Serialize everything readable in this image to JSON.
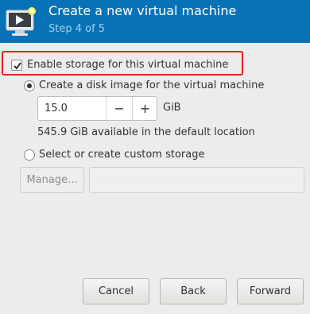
{
  "header": {
    "title": "Create a new virtual machine",
    "step": "Step 4 of 5",
    "icon": "virtual-machine-monitor-icon",
    "background_color": "#0772b7"
  },
  "storage": {
    "enable_label": "Enable storage for this virtual machine",
    "enable_checked": true,
    "highlight_color": "#e8211c",
    "disk_image_label": "Create a disk image for the virtual machine",
    "disk_image_selected": true,
    "size_value": "15.0",
    "size_minus": "−",
    "size_plus": "+",
    "size_unit": "GiB",
    "available_text": "545.9 GiB available in the default location",
    "custom_label": "Select or create custom storage",
    "custom_selected": false,
    "manage_label": "Manage...",
    "custom_path_value": ""
  },
  "footer": {
    "cancel_label": "Cancel",
    "back_label": "Back",
    "forward_label": "Forward"
  }
}
